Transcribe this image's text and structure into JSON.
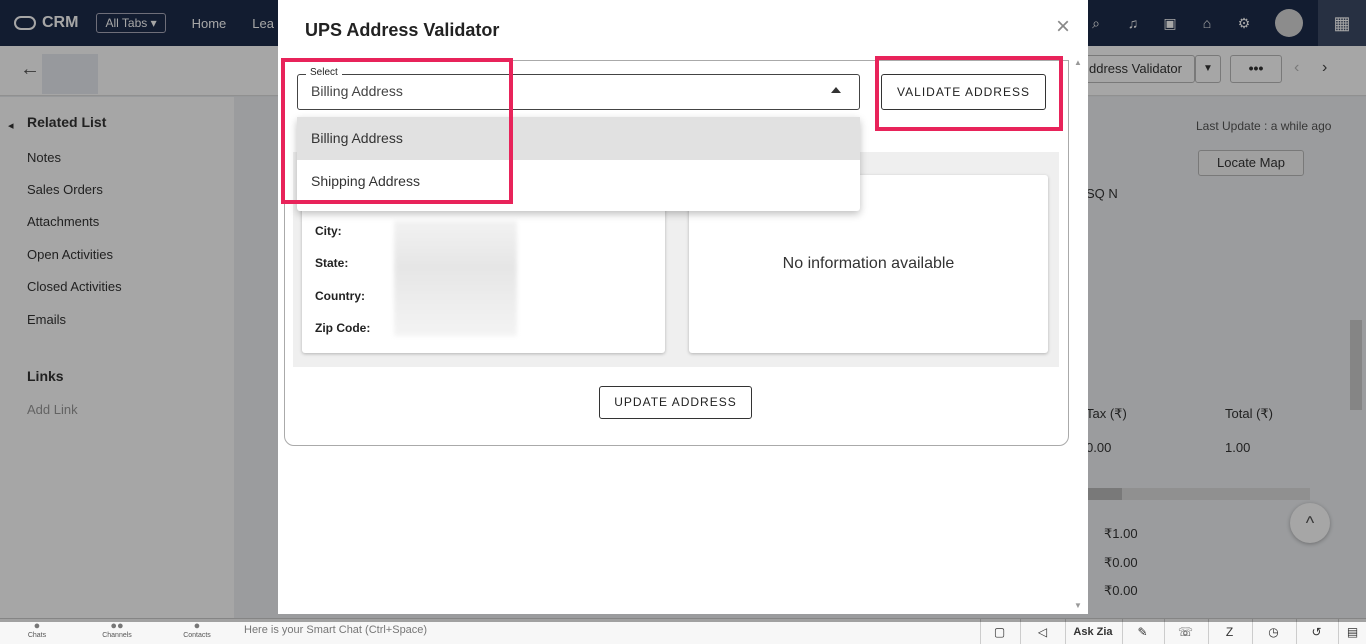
{
  "topnav": {
    "app_name": "CRM",
    "all_tabs": "All Tabs",
    "links": [
      "Home",
      "Lea"
    ]
  },
  "subbar": {
    "address_validator_btn": "ddress Validator",
    "more_btn": "•••"
  },
  "sidebar": {
    "related_list_title": "Related List",
    "items": [
      "Notes",
      "Sales Orders",
      "Attachments",
      "Open Activities",
      "Closed Activities",
      "Emails"
    ],
    "links_title": "Links",
    "add_link": "Add Link"
  },
  "record": {
    "last_update": "Last Update : a while ago",
    "locate_map": "Locate Map",
    "sqn": "SQ N",
    "tax_header": "Tax (₹)",
    "total_header": "Total (₹)",
    "tax_value": "0.00",
    "total_value": "1.00",
    "summary_1": "₹1.00",
    "summary_2": "₹0.00",
    "summary_3": "₹0.00"
  },
  "bottombar": {
    "chats": "Chats",
    "channels": "Channels",
    "contacts": "Contacts",
    "smart_chat": "Here is your Smart Chat (Ctrl+Space)",
    "ask_zia": "Ask Zia"
  },
  "modal": {
    "title": "UPS Address Validator",
    "select_label": "Select",
    "select_value": "Billing Address",
    "options": [
      "Billing Address",
      "Shipping Address"
    ],
    "validate_btn": "VALIDATE ADDRESS",
    "fields": [
      "City:",
      "State:",
      "Country:",
      "Zip Code:"
    ],
    "no_info": "No information available",
    "update_btn": "UPDATE ADDRESS"
  },
  "colors": {
    "highlight": "#e8235a",
    "topnav": "#1c2b4a"
  }
}
